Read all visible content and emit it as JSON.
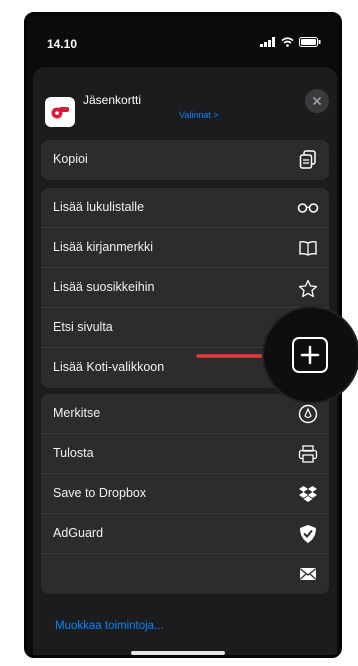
{
  "status_bar": {
    "time": "14.10"
  },
  "header": {
    "title": "Jäsenkortti",
    "options_link": "Valinnat >"
  },
  "groups": [
    [
      {
        "label": "Kopioi",
        "icon": "copy-icon"
      }
    ],
    [
      {
        "label": "Lisää lukulistalle",
        "icon": "glasses-icon"
      },
      {
        "label": "Lisää kirjanmerkki",
        "icon": "book-icon"
      },
      {
        "label": "Lisää suosikkeihin",
        "icon": "star-icon"
      },
      {
        "label": "Etsi sivulta",
        "icon": "search-icon"
      },
      {
        "label": "Lisää Koti-valikkoon",
        "icon": "add-square-icon"
      }
    ],
    [
      {
        "label": "Merkitse",
        "icon": "markup-icon"
      },
      {
        "label": "Tulosta",
        "icon": "print-icon"
      },
      {
        "label": "Save to Dropbox",
        "icon": "dropbox-icon"
      },
      {
        "label": "AdGuard",
        "icon": "shield-check-icon"
      },
      {
        "label": "",
        "icon": "mail-icon"
      }
    ]
  ],
  "footer": {
    "edit_actions": "Muokkaa toimintoja..."
  },
  "colors": {
    "accent": "#0a84ff",
    "arrow": "#e53935",
    "sheet": "#1c1c1e",
    "group": "#2c2c2e"
  }
}
